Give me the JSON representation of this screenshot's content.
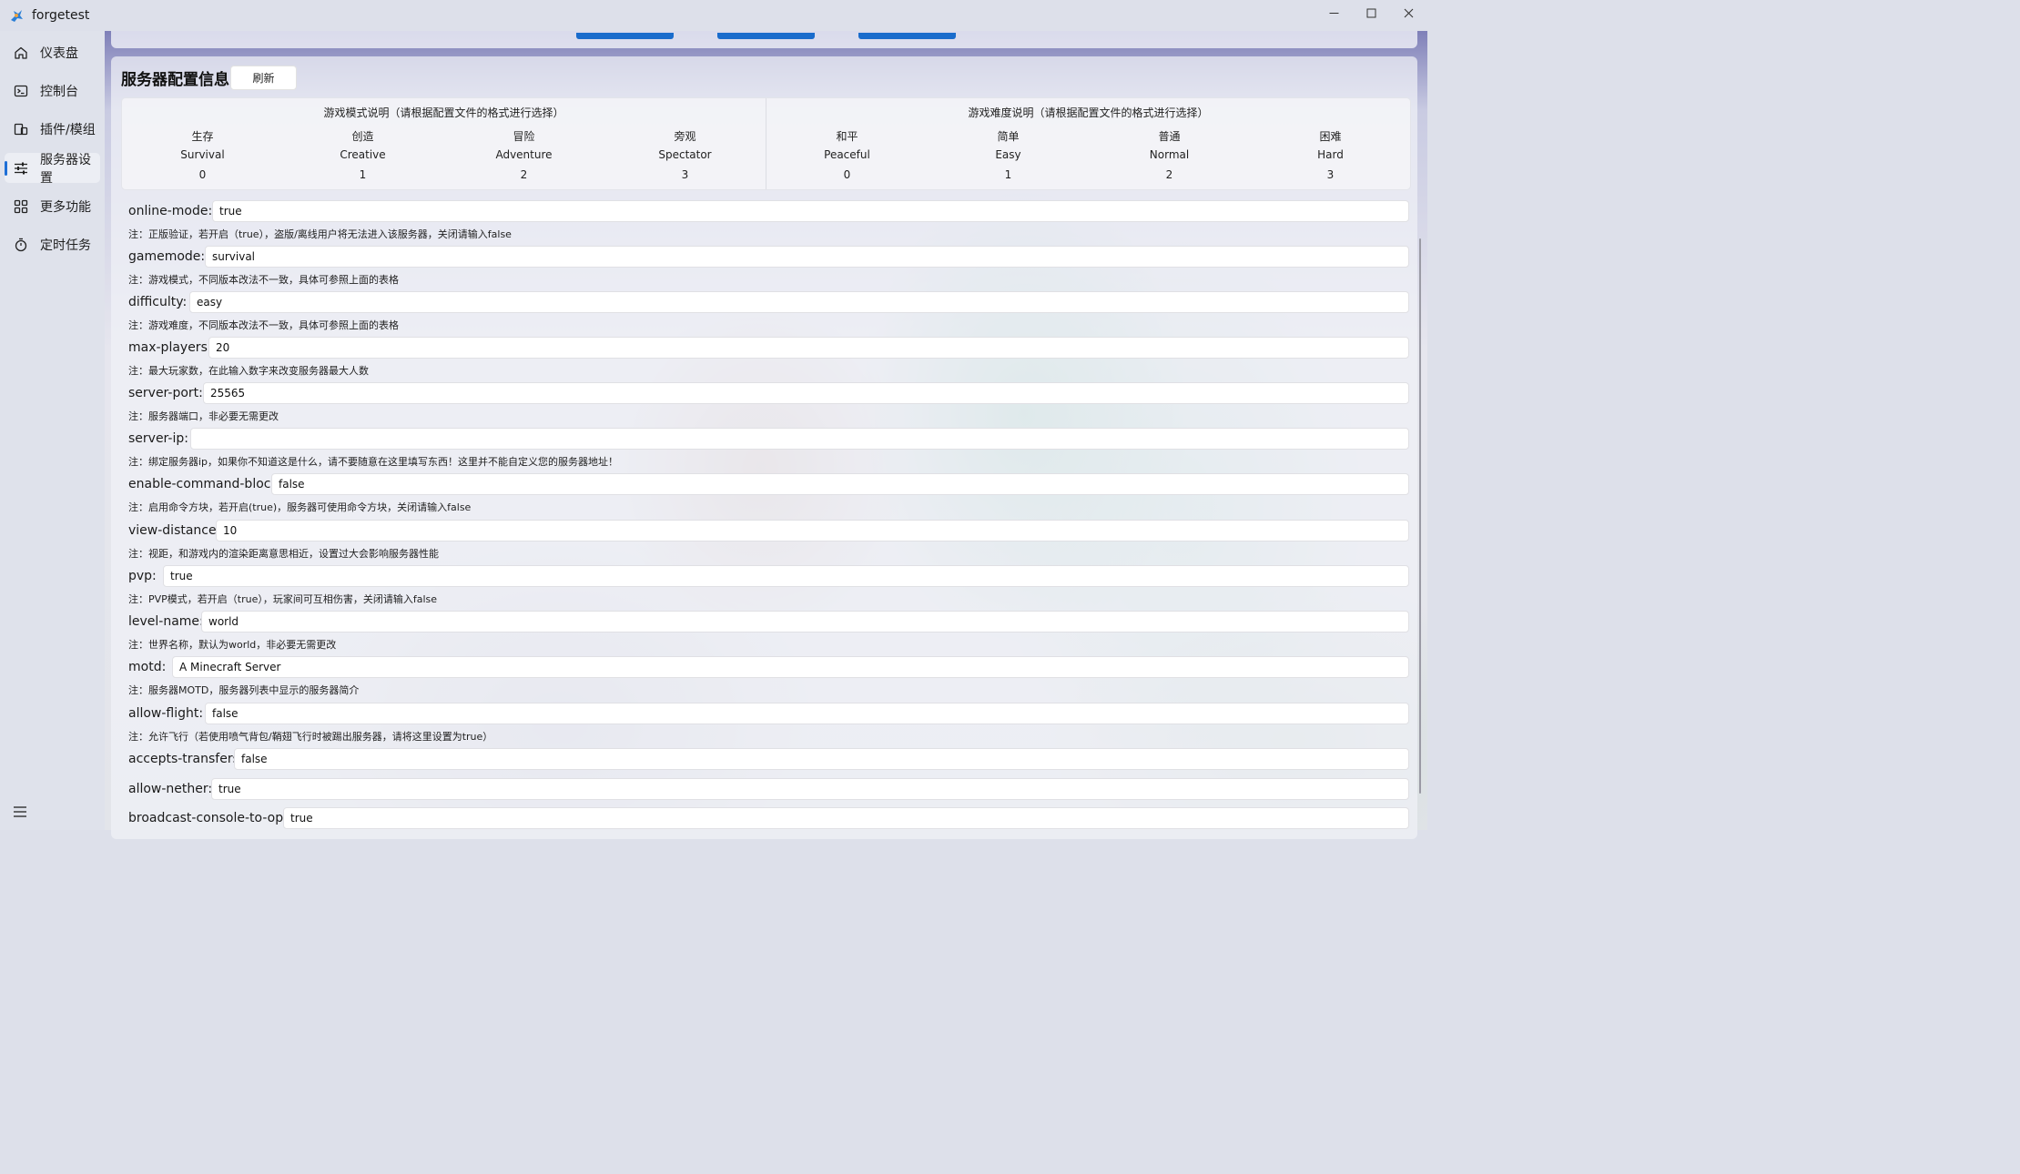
{
  "window": {
    "title": "forgetest"
  },
  "sidebar": {
    "items": [
      {
        "label": "仪表盘",
        "icon": "home-icon"
      },
      {
        "label": "控制台",
        "icon": "terminal-icon"
      },
      {
        "label": "插件/模组",
        "icon": "plugin-icon"
      },
      {
        "label": "服务器设置",
        "icon": "settings-sliders-icon",
        "active": true
      },
      {
        "label": "更多功能",
        "icon": "grid-icon"
      },
      {
        "label": "定时任务",
        "icon": "timer-icon"
      }
    ]
  },
  "section": {
    "title": "服务器配置信息",
    "refresh_label": "刷新"
  },
  "info_table": {
    "gamemode": {
      "header": "游戏模式说明（请根据配置文件的格式进行选择）",
      "cols": [
        {
          "cn": "生存",
          "en": "Survival",
          "num": "0"
        },
        {
          "cn": "创造",
          "en": "Creative",
          "num": "1"
        },
        {
          "cn": "冒险",
          "en": "Adventure",
          "num": "2"
        },
        {
          "cn": "旁观",
          "en": "Spectator",
          "num": "3"
        }
      ]
    },
    "difficulty": {
      "header": "游戏难度说明（请根据配置文件的格式进行选择）",
      "cols": [
        {
          "cn": "和平",
          "en": "Peaceful",
          "num": "0"
        },
        {
          "cn": "简单",
          "en": "Easy",
          "num": "1"
        },
        {
          "cn": "普通",
          "en": "Normal",
          "num": "2"
        },
        {
          "cn": "困难",
          "en": "Hard",
          "num": "3"
        }
      ]
    }
  },
  "fields": [
    {
      "label": "online-mode:",
      "value": "true",
      "note": "注：正版验证，若开启（true），盗版/离线用户将无法进入该服务器，关闭请输入false"
    },
    {
      "label": "gamemode:",
      "value": "survival",
      "note": "注：游戏模式，不同版本改法不一致，具体可参照上面的表格"
    },
    {
      "label": "difficulty:",
      "value": "easy",
      "note": "注：游戏难度，不同版本改法不一致，具体可参照上面的表格"
    },
    {
      "label": "max-players:",
      "value": "20",
      "note": "注：最大玩家数，在此输入数字来改变服务器最大人数"
    },
    {
      "label": "server-port:",
      "value": "25565",
      "note": "注：服务器端口，非必要无需更改"
    },
    {
      "label": "server-ip:",
      "value": "",
      "note": "注：绑定服务器ip，如果你不知道这是什么，请不要随意在这里填写东西！这里并不能自定义您的服务器地址！"
    },
    {
      "label": "enable-command-block:",
      "value": "false",
      "note": "注：启用命令方块，若开启(true)，服务器可使用命令方块，关闭请输入false"
    },
    {
      "label": "view-distance:",
      "value": "10",
      "note": "注：视距，和游戏内的渲染距离意思相近，设置过大会影响服务器性能"
    },
    {
      "label": "pvp:",
      "value": "true",
      "note": "注：PVP模式，若开启（true），玩家间可互相伤害，关闭请输入false"
    },
    {
      "label": "level-name:",
      "value": "world",
      "note": "注：世界名称，默认为world，非必要无需更改"
    },
    {
      "label": "motd:",
      "value": "A Minecraft Server",
      "note": "注：服务器MOTD，服务器列表中显示的服务器简介"
    },
    {
      "label": "allow-flight:",
      "value": "false",
      "note": "注：允许飞行（若使用喷气背包/鞘翅飞行时被踢出服务器，请将这里设置为true）"
    },
    {
      "label": "accepts-transfers:",
      "value": "false"
    },
    {
      "label": "allow-nether:",
      "value": "true"
    },
    {
      "label": "broadcast-console-to-ops:",
      "value": "true"
    }
  ],
  "colors": {
    "accent": "#1a6ccc",
    "sidebar_bg": "#dfe2eb"
  }
}
